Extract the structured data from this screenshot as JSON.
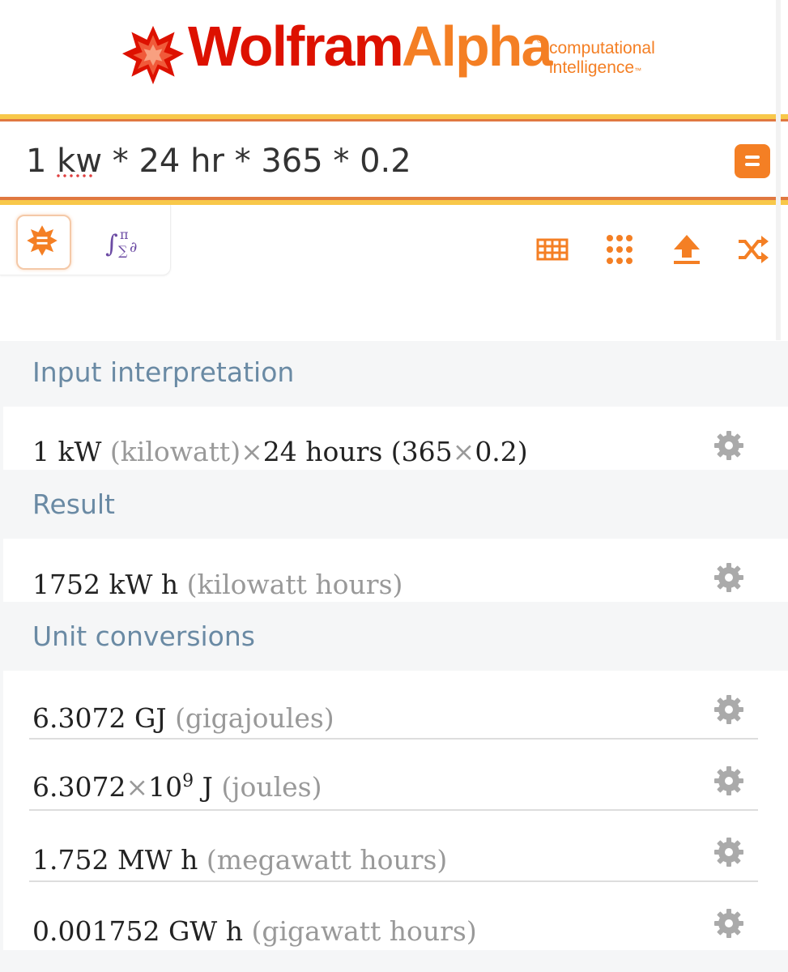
{
  "header": {
    "logo_wolfram": "Wolfram",
    "logo_alpha": "Alpha",
    "tagline_1": "computational",
    "tagline_2": "intelligence"
  },
  "search": {
    "query": "1 kw * 24 hr * 365 * 0.2"
  },
  "pods": {
    "input": {
      "title": "Input interpretation",
      "a": "1 kW",
      "a_gray": "(kilowatt)",
      "times1": "×",
      "b": "24 hours (365",
      "times2": "×",
      "c": "0.2)"
    },
    "result": {
      "title": "Result",
      "value": "1752 kW h",
      "unit": "(kilowatt hours)"
    },
    "conversions": {
      "title": "Unit conversions",
      "rows": [
        {
          "value": "6.3072 GJ",
          "unit": "(gigajoules)"
        },
        {
          "mantissa": "6.3072",
          "times": "×",
          "base": "10",
          "exp": "9",
          "sym": "J",
          "unit": "(joules)"
        },
        {
          "value": "1.752 MW h",
          "unit": "(megawatt hours)"
        },
        {
          "value": "0.001752 GW h",
          "unit": "(gigawatt hours)"
        }
      ]
    }
  },
  "colors": {
    "brand_red": "#dd1100",
    "brand_orange": "#f47f24",
    "pod_title": "#6a8aa4"
  }
}
